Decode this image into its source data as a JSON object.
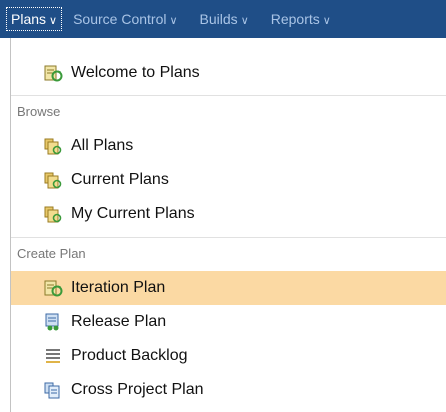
{
  "nav": {
    "tabs": [
      {
        "label": "Plans"
      },
      {
        "label": "Source Control"
      },
      {
        "label": "Builds"
      },
      {
        "label": "Reports"
      }
    ]
  },
  "menu": {
    "welcome": {
      "label": "Welcome to Plans"
    },
    "browse": {
      "heading": "Browse",
      "items": [
        {
          "label": "All Plans"
        },
        {
          "label": "Current Plans"
        },
        {
          "label": "My Current Plans"
        }
      ]
    },
    "create": {
      "heading": "Create Plan",
      "items": [
        {
          "label": "Iteration Plan"
        },
        {
          "label": "Release Plan"
        },
        {
          "label": "Product Backlog"
        },
        {
          "label": "Cross Project Plan"
        }
      ]
    }
  },
  "colors": {
    "nav_bg": "#1f4e87",
    "highlight": "#fbd9a3"
  }
}
